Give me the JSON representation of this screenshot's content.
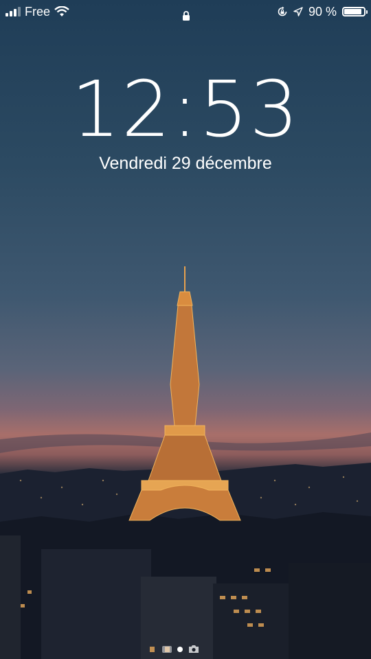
{
  "status": {
    "carrier": "Free",
    "battery_percent": "90 %",
    "battery_level": 0.9,
    "icons": [
      "signal-icon",
      "wifi-icon",
      "lock-icon",
      "rotation-lock-icon",
      "location-icon",
      "battery-icon"
    ]
  },
  "lock_screen": {
    "time": "12:53",
    "date": "Vendredi 29 décembre"
  },
  "page_indicator": {
    "pages": 3,
    "active_index": 1,
    "icons": [
      "widget-page-dot",
      "camera-icon"
    ]
  }
}
